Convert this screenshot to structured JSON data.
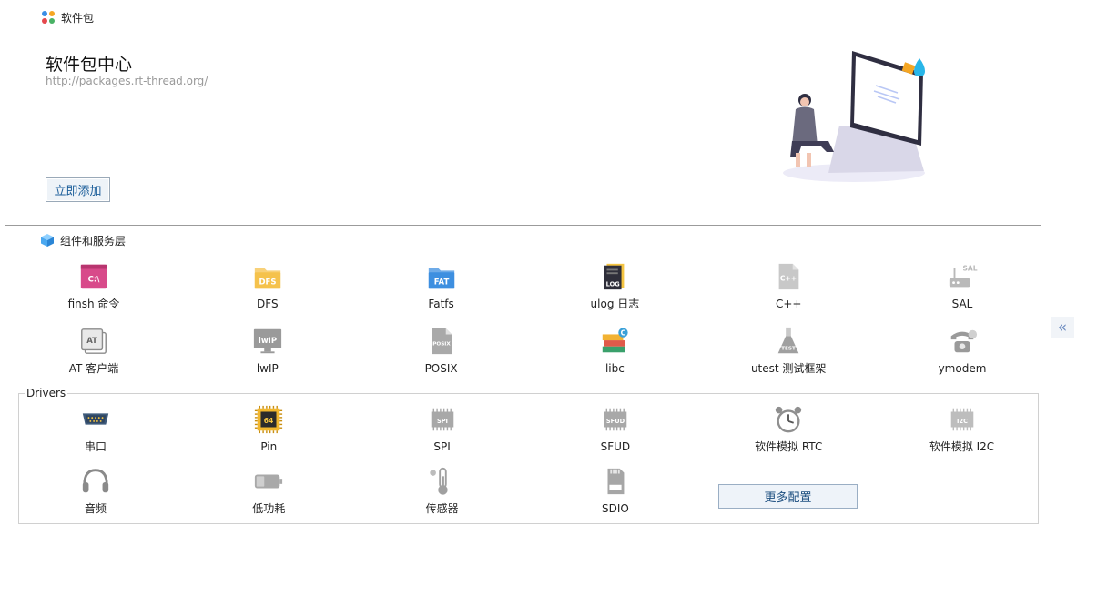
{
  "app": {
    "title": "软件包"
  },
  "hero": {
    "title": "软件包中心",
    "url": "http://packages.rt-thread.org/",
    "add_button": "立即添加"
  },
  "components": {
    "title": "组件和服务层",
    "items": [
      {
        "label": "finsh 命令",
        "icon": "terminal-icon",
        "color": "#d84a8a",
        "icon_text": "C:\\"
      },
      {
        "label": "DFS",
        "icon": "folder-dfs-icon",
        "color": "#f5c24c",
        "icon_text": "DFS"
      },
      {
        "label": "Fatfs",
        "icon": "folder-fat-icon",
        "color": "#3d8fe0",
        "icon_text": "FAT"
      },
      {
        "label": "ulog 日志",
        "icon": "log-book-icon",
        "color": "#2e2e3a",
        "icon_text": "LOG"
      },
      {
        "label": "C++",
        "icon": "cpp-file-icon",
        "color": "#c8c8c8",
        "icon_text": "C++"
      },
      {
        "label": "SAL",
        "icon": "router-icon",
        "color": "#b9b9b9",
        "icon_text": "SAL"
      },
      {
        "label": "AT 客户端",
        "icon": "at-client-icon",
        "color": "#8c8c8c",
        "icon_text": "AT"
      },
      {
        "label": "lwIP",
        "icon": "lwip-monitor-icon",
        "color": "#9a9a9a",
        "icon_text": "lwIP"
      },
      {
        "label": "POSIX",
        "icon": "posix-file-icon",
        "color": "#a9a9a9",
        "icon_text": "POSIX"
      },
      {
        "label": "libc",
        "icon": "books-icon",
        "color": "#3aa0d8",
        "icon_text": "C"
      },
      {
        "label": "utest 测试框架",
        "icon": "test-flask-icon",
        "color": "#a0a0a0",
        "icon_text": "TEST"
      },
      {
        "label": "ymodem",
        "icon": "telephone-icon",
        "color": "#9a9a9a",
        "icon_text": ""
      }
    ]
  },
  "drivers": {
    "title": "Drivers",
    "items": [
      {
        "label": "串口",
        "icon": "serial-port-icon",
        "color": "#3e5a7a",
        "icon_text": ""
      },
      {
        "label": "Pin",
        "icon": "chip-icon",
        "color": "#f2b72d",
        "icon_text": "64"
      },
      {
        "label": "SPI",
        "icon": "spi-chip-icon",
        "color": "#a8a8a8",
        "icon_text": "SPI"
      },
      {
        "label": "SFUD",
        "icon": "sfud-chip-icon",
        "color": "#a8a8a8",
        "icon_text": "SFUD"
      },
      {
        "label": "软件模拟 RTC",
        "icon": "alarm-clock-icon",
        "color": "#8f8f8f",
        "icon_text": ""
      },
      {
        "label": "软件模拟 I2C",
        "icon": "i2c-chip-icon",
        "color": "#bdbdbd",
        "icon_text": "I2C"
      },
      {
        "label": "音频",
        "icon": "headphones-icon",
        "color": "#8a8a8a",
        "icon_text": ""
      },
      {
        "label": "低功耗",
        "icon": "battery-icon",
        "color": "#a9a9a9",
        "icon_text": ""
      },
      {
        "label": "传感器",
        "icon": "thermometer-icon",
        "color": "#a0a0a0",
        "icon_text": ""
      },
      {
        "label": "SDIO",
        "icon": "sd-card-icon",
        "color": "#a6a6a6",
        "icon_text": ""
      }
    ],
    "more_button": "更多配置"
  },
  "sidebar_toggle": {
    "glyph": "«"
  }
}
